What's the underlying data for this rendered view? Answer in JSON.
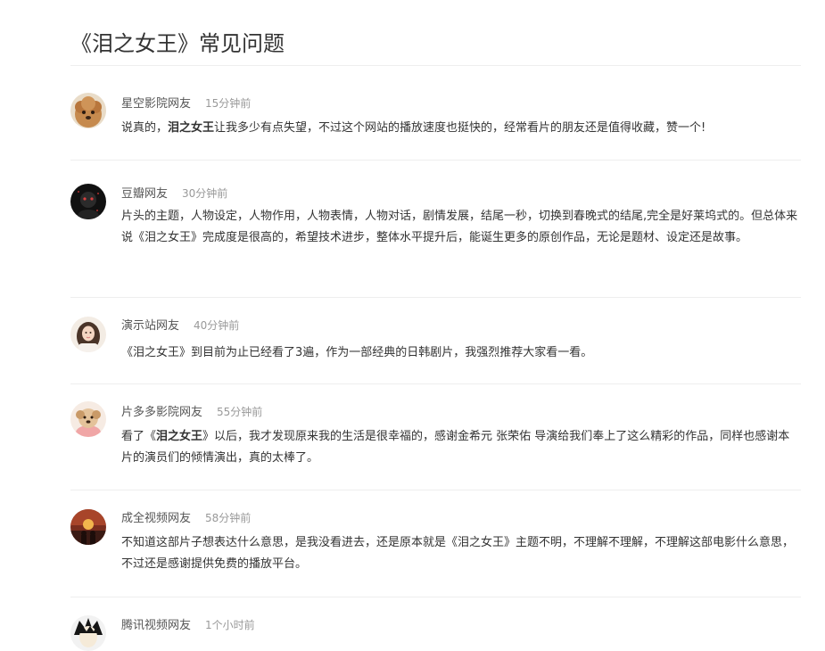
{
  "page_title": "《泪之女王》常见问题",
  "comments": [
    {
      "author": "星空影院网友",
      "time": "15分钟前",
      "parts": [
        {
          "text": "说真的，",
          "bold": false
        },
        {
          "text": "泪之女王",
          "bold": true
        },
        {
          "text": "让我多少有点失望，不过这个网站的播放速度也挺快的，经常看片的朋友还是值得收藏，赞一个!",
          "bold": false
        }
      ]
    },
    {
      "author": "豆瓣网友",
      "time": "30分钟前",
      "parts": [
        {
          "text": "片头的主题，人物设定，人物作用，人物表情，人物对话，剧情发展，结尾一秒，切换到春晚式的结尾,完全是好莱坞式的。但总体来说《泪之女王》完成度是很高的，希望技术进步，整体水平提升后，能诞生更多的原创作品，无论是题材、设定还是故事。",
          "bold": false
        }
      ]
    },
    {
      "author": "演示站网友",
      "time": "40分钟前",
      "parts": [
        {
          "text": "《泪之女王》到目前为止已经看了3遍，作为一部经典的日韩剧片，我强烈推荐大家看一看。",
          "bold": false
        }
      ]
    },
    {
      "author": "片多多影院网友",
      "time": "55分钟前",
      "parts": [
        {
          "text": "看了《",
          "bold": false
        },
        {
          "text": "泪之女王",
          "bold": true
        },
        {
          "text": "》以后，我才发现原来我的生活是很幸福的，感谢金希元 张荣佑 导演给我们奉上了这么精彩的作品，同样也感谢本片的演员们的倾情演出，真的太棒了。",
          "bold": false
        }
      ]
    },
    {
      "author": "成全视频网友",
      "time": "58分钟前",
      "parts": [
        {
          "text": "不知道这部片子想表达什么意思，是我没看进去，还是原本就是《泪之女王》主题不明，不理解不理解，不理解这部电影什么意思，不过还是感谢提供免费的播放平台。",
          "bold": false
        }
      ]
    },
    {
      "author": "腾讯视频网友",
      "time": "1个小时前",
      "parts": []
    }
  ],
  "avatar_icons": [
    "poodle-avatar-icon",
    "dark-portrait-avatar-icon",
    "girl-portrait-avatar-icon",
    "puppy-avatar-icon",
    "sunset-silhouette-avatar-icon",
    "anime-boy-avatar-icon"
  ],
  "colors": {
    "text": "#333333",
    "author": "#555555",
    "time": "#999999",
    "divider": "#eeeeee"
  }
}
